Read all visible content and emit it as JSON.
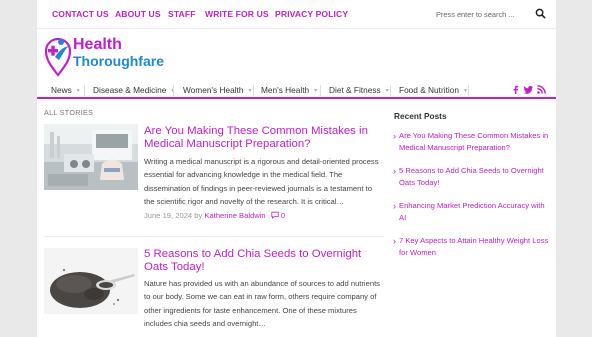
{
  "topbar": {
    "links": [
      "CONTACT US",
      "ABOUT US",
      "STAFF",
      "WRITE FOR US",
      "PRIVACY POLICY"
    ],
    "search_placeholder": "Press enter to search ..."
  },
  "logo": {
    "line1": "Health",
    "line2": "Thoroughfare"
  },
  "nav": {
    "items": [
      "News",
      "Disease & Medicine",
      "Women's Health",
      "Men's Health",
      "Diet & Fitness",
      "Food & Nutrition"
    ]
  },
  "main": {
    "section_label": "ALL STORIES",
    "posts": [
      {
        "title": "Are You Making These Common Mistakes in Medical Manuscript Preparation?",
        "excerpt": "Writing a medical manuscript is a rigorous and detail-oriented process essential for advancing knowledge in the medical field. The dissemination of findings in peer-reviewed journals is a testament to the scientific rigor and novelty of the research. It is critical…",
        "date": "June 19, 2024",
        "by": "by",
        "author": "Katherine Baldwin",
        "comments": "0"
      },
      {
        "title": "5 Reasons to Add Chia Seeds to Overnight Oats Today!",
        "excerpt": "Nature has provided us with an abundance of sources to add nutrients to our body. Some we can eat in raw form, others require company of other ingredients for taste enhancement. One of these mixtures includes chia seeds and overnight…"
      }
    ]
  },
  "sidebar": {
    "title": "Recent Posts",
    "items": [
      "Are You Making These Common Mistakes in Medical Manuscript Preparation?",
      "5 Reasons to Add Chia Seeds to Overnight Oats Today!",
      "Enhancing Market Prediction Accuracy with AI",
      "7 Key Aspects to Attain Healthy Weight Loss for Women"
    ]
  },
  "colors": {
    "accent": "#c020c8",
    "logo_blue": "#1e88d0"
  }
}
